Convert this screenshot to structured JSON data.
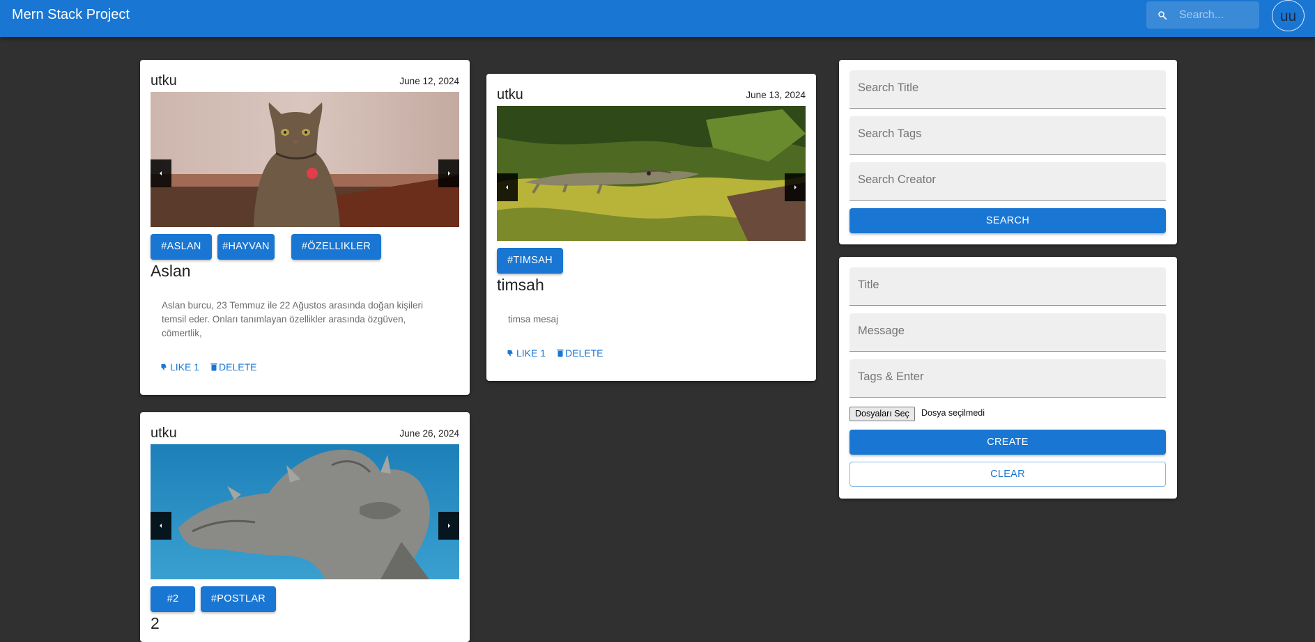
{
  "app": {
    "title": "Mern Stack Project",
    "search_placeholder": "Search...",
    "avatar_initials": "uu",
    "accent_color": "#1976d2"
  },
  "posts": [
    {
      "author": "utku",
      "date": "June 12, 2024",
      "image": "cat",
      "tags": [
        "#ASLAN",
        "#HAYVAN",
        "#ÖZELLIKLER"
      ],
      "title": "Aslan",
      "message": "Aslan burcu, 23 Temmuz ile 22 Ağustos arasında doğan kişileri temsil eder. Onları tanımlayan özellikler arasında özgüven, cömertlik,",
      "like_label": "LIKE 1",
      "delete_label": "DELETE"
    },
    {
      "author": "utku",
      "date": "June 13, 2024",
      "image": "crocodile",
      "tags": [
        "#TIMSAH"
      ],
      "title": "timsah",
      "message": "timsa mesaj",
      "like_label": "LIKE 1",
      "delete_label": "DELETE"
    },
    {
      "author": "utku",
      "date": "June 26, 2024",
      "image": "dragon-statue",
      "tags": [
        "#2",
        "#POSTLAR"
      ],
      "title": "2"
    }
  ],
  "search_form": {
    "title_placeholder": "Search Title",
    "tags_placeholder": "Search Tags",
    "creator_placeholder": "Search Creator",
    "button_label": "SEARCH"
  },
  "create_form": {
    "title_placeholder": "Title",
    "message_placeholder": "Message",
    "tags_placeholder": "Tags & Enter",
    "file_button_label": "Dosyaları Seç",
    "file_status": "Dosya seçilmedi",
    "create_label": "CREATE",
    "clear_label": "CLEAR"
  }
}
